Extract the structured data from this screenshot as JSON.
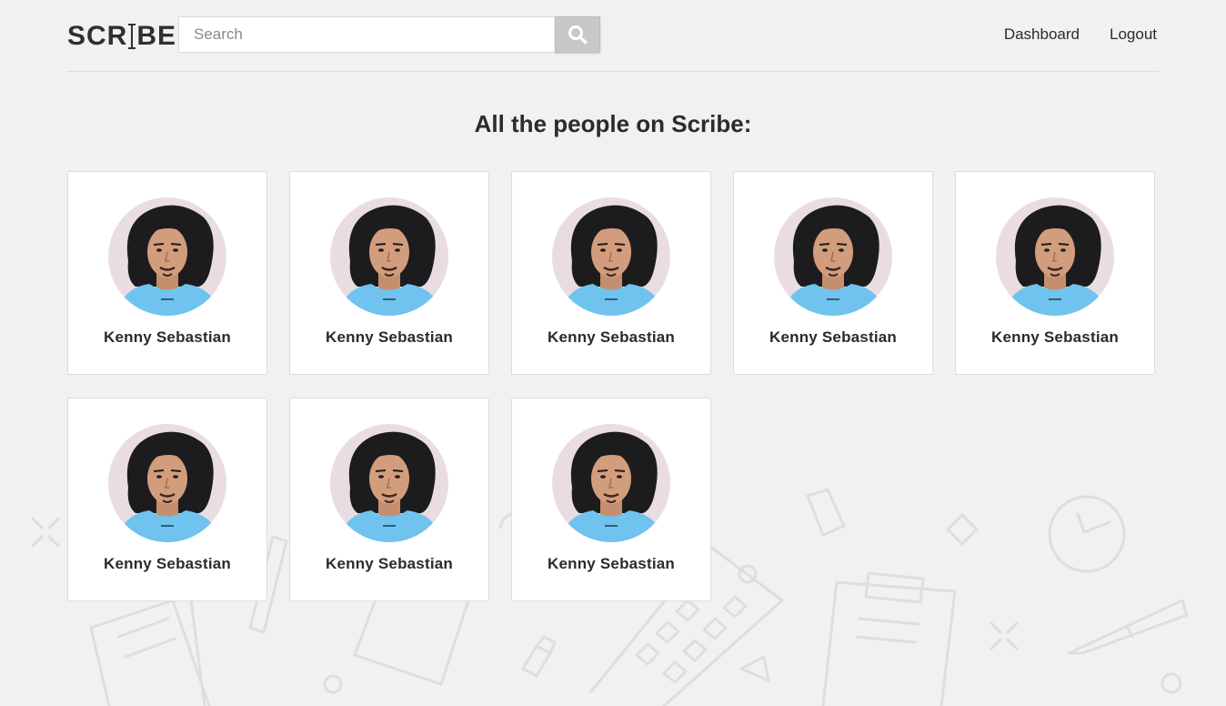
{
  "header": {
    "logo_text_left": "SCR",
    "logo_text_right": "BE",
    "search": {
      "placeholder": "Search",
      "value": ""
    },
    "search_button_icon": "search-icon",
    "nav": [
      {
        "label": "Dashboard"
      },
      {
        "label": "Logout"
      }
    ]
  },
  "main": {
    "title": "All the people on Scribe:",
    "people": [
      {
        "name": "Kenny Sebastian"
      },
      {
        "name": "Kenny Sebastian"
      },
      {
        "name": "Kenny Sebastian"
      },
      {
        "name": "Kenny Sebastian"
      },
      {
        "name": "Kenny Sebastian"
      },
      {
        "name": "Kenny Sebastian"
      },
      {
        "name": "Kenny Sebastian"
      },
      {
        "name": "Kenny Sebastian"
      }
    ]
  },
  "colors": {
    "background": "#f1f1f1",
    "card": "#ffffff",
    "text": "#2b2b2b",
    "search_button": "#c8c8c8",
    "avatar_shirt": "#6fc3ee",
    "avatar_bg": "#e9dde2"
  }
}
